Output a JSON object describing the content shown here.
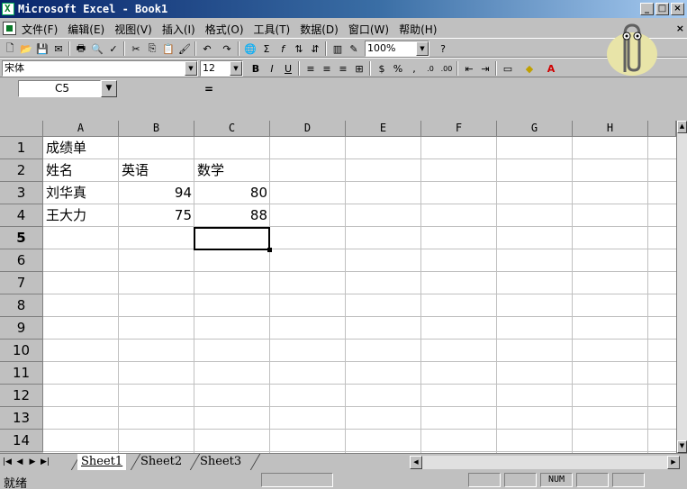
{
  "window": {
    "title": "Microsoft Excel - Book1"
  },
  "menu": {
    "items": [
      "文件(F)",
      "编辑(E)",
      "视图(V)",
      "插入(I)",
      "格式(O)",
      "工具(T)",
      "数据(D)",
      "窗口(W)",
      "帮助(H)"
    ]
  },
  "standard_toolbar": {
    "zoom": "100%"
  },
  "formatting_toolbar": {
    "font": "宋体",
    "size": "12"
  },
  "formula_bar": {
    "name_box": "C5",
    "equals": "=",
    "content": ""
  },
  "sheet": {
    "columns": [
      "A",
      "B",
      "C",
      "D",
      "E",
      "F",
      "G",
      "H"
    ],
    "rows": [
      "1",
      "2",
      "3",
      "4",
      "5",
      "6",
      "7",
      "8",
      "9",
      "10",
      "11",
      "12",
      "13",
      "14"
    ],
    "active_cell": "C5",
    "cells": {
      "A1": "成绩单",
      "A2": "姓名",
      "B2": "英语",
      "C2": "数学",
      "A3": "刘华真",
      "B3": "94",
      "C3": "80",
      "A4": "王大力",
      "B4": "75",
      "C4": "88"
    }
  },
  "tabs": [
    "Sheet1",
    "Sheet2",
    "Sheet3"
  ],
  "status": {
    "text": "就绪",
    "num_indicator": "NUM"
  },
  "colors": {
    "titlebar": "#08246b",
    "chrome": "#c0c0c0",
    "selection": "#000000"
  }
}
